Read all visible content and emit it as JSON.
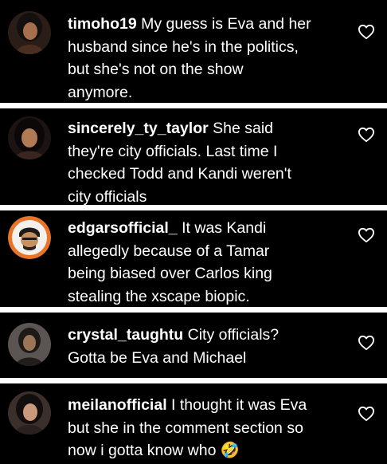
{
  "comments": [
    {
      "username": "timoho19",
      "text": "My guess is Eva and her\nhusband since he's in the politics,\nbut she's not on the show\nanymore.",
      "avatar_icon": "profile-photo",
      "like_icon": "heart-outline-icon"
    },
    {
      "username": "sincerely_ty_taylor",
      "text": "She said\nthey're city officials. Last time I\nchecked Todd and Kandi weren't\ncity officials",
      "avatar_icon": "profile-photo",
      "like_icon": "heart-outline-icon"
    },
    {
      "username": "edgarsofficial_",
      "text": "It was Kandi\nallegedly because of a Tamar\nbeing biased over Carlos king\nstealing the xscape biopic.",
      "avatar_icon": "profile-photo",
      "like_icon": "heart-outline-icon"
    },
    {
      "username": "crystal_taughtu",
      "text": "City officials?\nGotta be Eva and Michael",
      "avatar_icon": "profile-photo",
      "like_icon": "heart-outline-icon"
    },
    {
      "username": "meilanofficial",
      "text": "I thought it was Eva\nbut she in the comment section so\nnow i gotta know who 🤣",
      "avatar_icon": "profile-photo",
      "like_icon": "heart-outline-icon"
    }
  ],
  "colors": {
    "background": "#000000",
    "separator": "#ffffff",
    "text": "#ffffff",
    "edgar_avatar_ring": "#e8742a"
  }
}
